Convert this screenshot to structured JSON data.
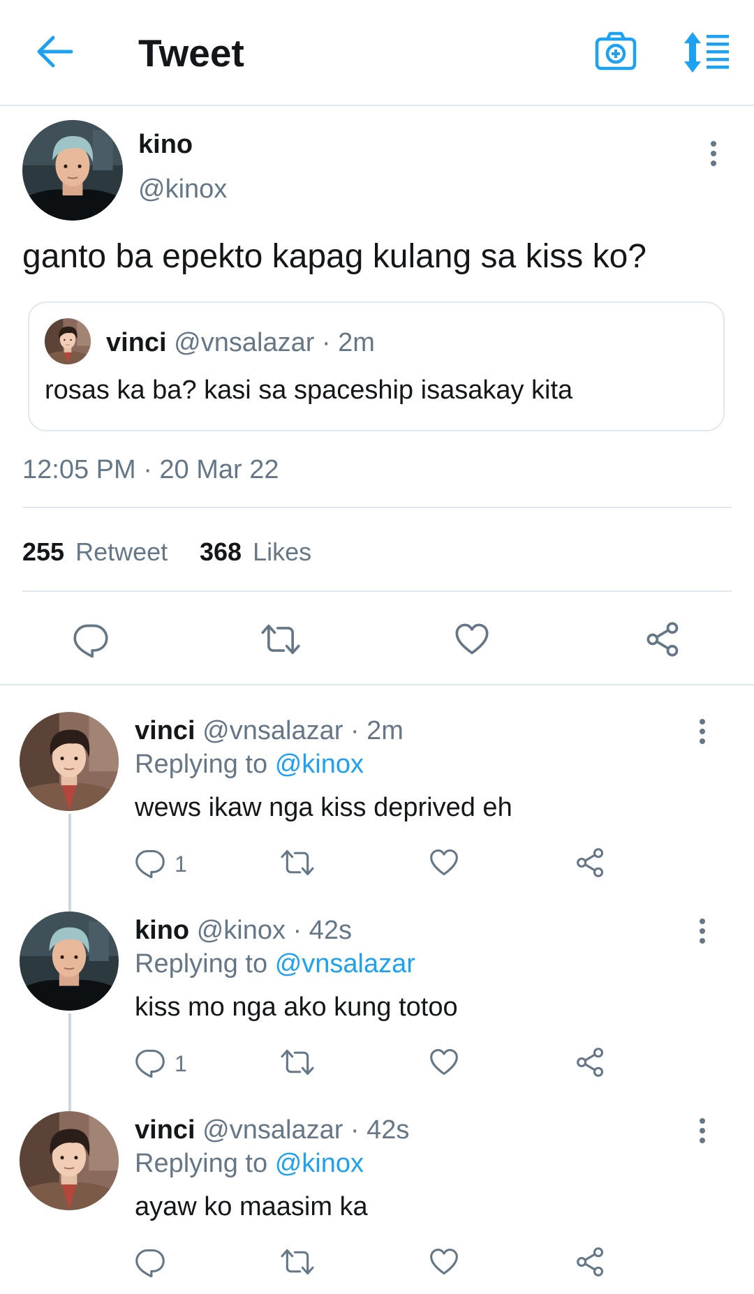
{
  "header": {
    "title": "Tweet"
  },
  "tweet": {
    "author_name": "kino",
    "author_handle": "@kinox",
    "text": "ganto ba epekto kapag kulang sa kiss ko?",
    "quoted": {
      "name": "vinci",
      "handle_time": "@vnsalazar · 2m",
      "text": "rosas ka ba? kasi sa spaceship isasakay kita"
    },
    "timestamp": "12:05 PM · 20 Mar 22",
    "retweet_count": "255",
    "retweet_label": "Retweet",
    "like_count": "368",
    "like_label": "Likes"
  },
  "replies": [
    {
      "name": "vinci",
      "handle_time": "@vnsalazar · 2m",
      "replying_prefix": "Replying to",
      "replying_to": "@kinox",
      "text": "wews ikaw nga kiss deprived eh",
      "reply_count": "1"
    },
    {
      "name": "kino",
      "handle_time": "@kinox · 42s",
      "replying_prefix": "Replying to",
      "replying_to": "@vnsalazar",
      "text": "kiss mo nga ako kung totoo",
      "reply_count": "1"
    },
    {
      "name": "vinci",
      "handle_time": "@vnsalazar · 42s",
      "replying_prefix": "Replying to",
      "replying_to": "@kinox",
      "text": "ayaw ko maasim ka",
      "reply_count": ""
    }
  ],
  "icons": {
    "back": "back-arrow-icon",
    "camera": "camera-icon",
    "sort": "sort-icon",
    "more": "more-vertical-icon",
    "reply": "reply-icon",
    "retweet": "retweet-icon",
    "like": "heart-icon",
    "share": "share-icon"
  },
  "colors": {
    "accent": "#1da1f2",
    "muted": "#657786",
    "text": "#14171a",
    "border": "#e1e8ed"
  }
}
